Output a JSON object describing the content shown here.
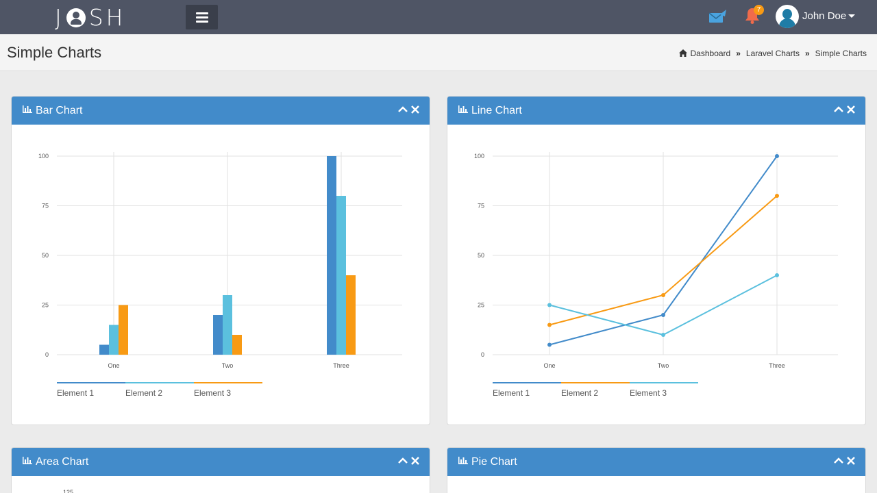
{
  "app": {
    "logo_letters": [
      "J",
      "SH"
    ],
    "user_name": "John Doe",
    "notification_count": "7"
  },
  "header": {
    "title": "Simple Charts",
    "breadcrumb": [
      "Dashboard",
      "Laravel Charts",
      "Simple Charts"
    ],
    "breadcrumb_separator": "»"
  },
  "colors": {
    "navbar": "#4f5565",
    "panel_header": "#428bca",
    "element1": "#428bca",
    "element2": "#5bc0de",
    "element3": "#f89a14",
    "mail_icon": "#4aa3df",
    "bell_icon": "#f06b4b"
  },
  "panels": [
    {
      "title": "Bar Chart"
    },
    {
      "title": "Line Chart"
    },
    {
      "title": "Area Chart"
    },
    {
      "title": "Pie Chart"
    }
  ],
  "chart_data": [
    {
      "type": "bar",
      "title": "Bar Chart",
      "categories": [
        "One",
        "Two",
        "Three"
      ],
      "yticks": [
        0,
        25,
        50,
        75,
        100
      ],
      "ylim": [
        0,
        100
      ],
      "grid": true,
      "legend_position": "bottom-left",
      "series": [
        {
          "name": "Element 1",
          "color": "#428bca",
          "values": [
            5,
            20,
            100
          ]
        },
        {
          "name": "Element 2",
          "color": "#5bc0de",
          "values": [
            15,
            30,
            80
          ]
        },
        {
          "name": "Element 3",
          "color": "#f89a14",
          "values": [
            25,
            10,
            40
          ]
        }
      ]
    },
    {
      "type": "line",
      "title": "Line Chart",
      "categories": [
        "One",
        "Two",
        "Three"
      ],
      "yticks": [
        0,
        25,
        50,
        75,
        100
      ],
      "ylim": [
        0,
        100
      ],
      "grid": true,
      "legend_position": "bottom-left",
      "series": [
        {
          "name": "Element 1",
          "color": "#428bca",
          "values": [
            5,
            20,
            100
          ]
        },
        {
          "name": "Element 2",
          "color": "#f89a14",
          "values": [
            15,
            30,
            80
          ]
        },
        {
          "name": "Element 3",
          "color": "#5bc0de",
          "values": [
            25,
            10,
            40
          ]
        }
      ]
    },
    {
      "type": "area",
      "title": "Area Chart",
      "categories": [],
      "yticks": [
        125
      ],
      "series": []
    }
  ]
}
